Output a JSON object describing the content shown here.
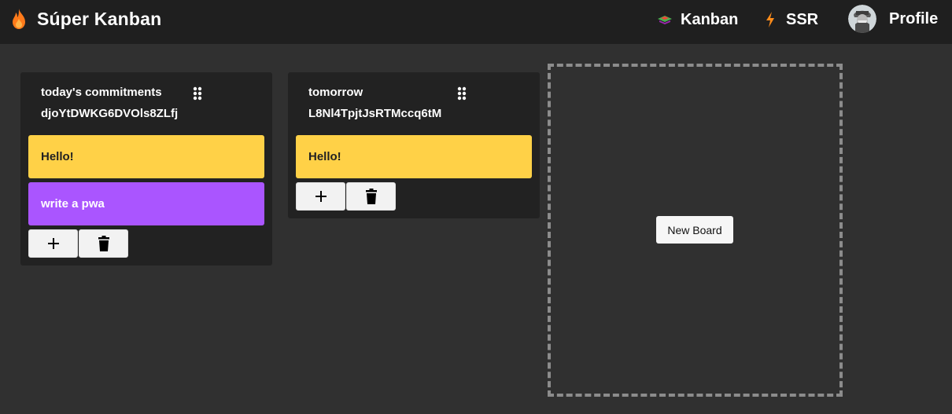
{
  "header": {
    "brand_icon": "flame-icon",
    "title": "Súper Kanban",
    "nav": [
      {
        "label": "Kanban",
        "icon": "kanban-icon"
      },
      {
        "label": "SSR",
        "icon": "lightning-icon"
      },
      {
        "label": "Profile",
        "icon": "avatar"
      }
    ]
  },
  "colors": {
    "background": "#303030",
    "topbar": "#1f1f1f",
    "column": "#222222",
    "card_yellow": "#ffd147",
    "card_purple": "#aa55ff",
    "flame": "#ff7a1a"
  },
  "boards": [
    {
      "title": "today's commitments",
      "id": "djoYtDWKG6DVOls8ZLfj",
      "cards": [
        {
          "text": "Hello!",
          "color": "yellow"
        },
        {
          "text": "write a pwa",
          "color": "purple"
        }
      ],
      "add_icon": "plus-icon",
      "delete_icon": "trash-icon"
    },
    {
      "title": "tomorrow",
      "id": "L8Nl4TpjtJsRTMccq6tM",
      "cards": [
        {
          "text": "Hello!",
          "color": "yellow"
        }
      ],
      "add_icon": "plus-icon",
      "delete_icon": "trash-icon"
    }
  ],
  "new_board_label": "New Board"
}
